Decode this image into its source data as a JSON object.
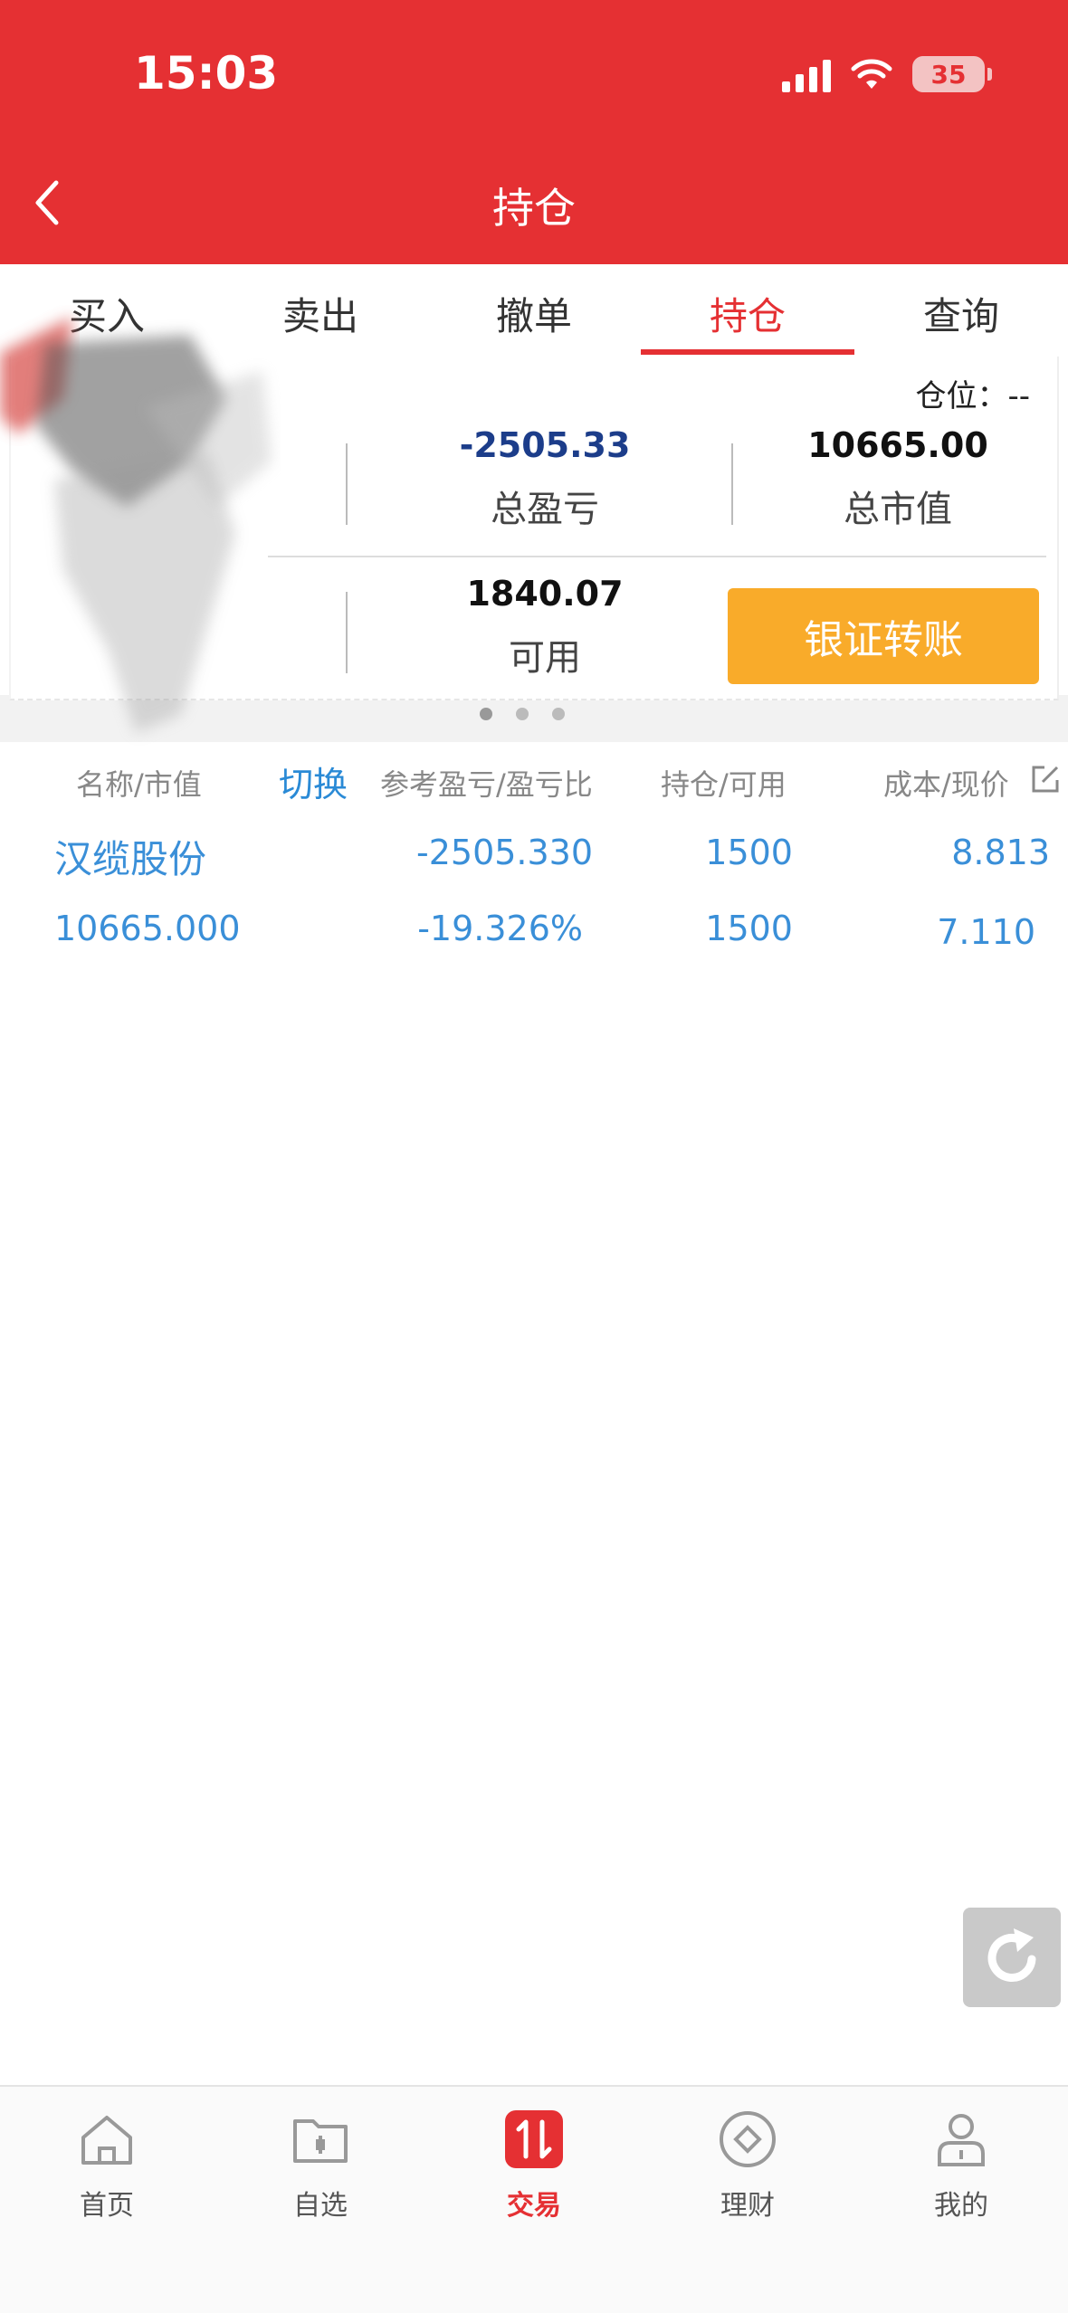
{
  "status_bar": {
    "time": "15:03",
    "battery": "35"
  },
  "nav": {
    "title": "持仓"
  },
  "tabs": [
    {
      "label": "买入",
      "active": false
    },
    {
      "label": "卖出",
      "active": false
    },
    {
      "label": "撤单",
      "active": false
    },
    {
      "label": "持仓",
      "active": true
    },
    {
      "label": "查询",
      "active": false
    }
  ],
  "summary": {
    "position_label": "仓位：--",
    "total_pnl_value": "-2505.33",
    "total_pnl_label": "总盈亏",
    "market_value": "10665.00",
    "market_value_label": "总市值",
    "available_value": "1840.07",
    "available_label": "可用",
    "transfer_button": "银证转账"
  },
  "table": {
    "headers": {
      "name": "名称/市值",
      "switch": "切换",
      "pnl": "参考盈亏/盈亏比",
      "hold": "持仓/可用",
      "cost": "成本/现价"
    },
    "rows": [
      {
        "name": "汉缆股份",
        "market_value": "10665.000",
        "pnl": "-2505.330",
        "pnl_ratio": "-19.326%",
        "hold": "1500",
        "available": "1500",
        "cost": "8.813",
        "price": "7.110"
      }
    ]
  },
  "bottom_nav": [
    {
      "label": "首页",
      "icon": "home-icon",
      "active": false
    },
    {
      "label": "自选",
      "icon": "folder-icon",
      "active": false
    },
    {
      "label": "交易",
      "icon": "trade-icon",
      "active": true
    },
    {
      "label": "理财",
      "icon": "finance-icon",
      "active": false
    },
    {
      "label": "我的",
      "icon": "user-icon",
      "active": false
    }
  ],
  "colors": {
    "brand_red": "#e53033",
    "button_orange": "#f9ab2a",
    "link_blue": "#3a8fd8",
    "pnl_dark_blue": "#1c3d8a"
  }
}
